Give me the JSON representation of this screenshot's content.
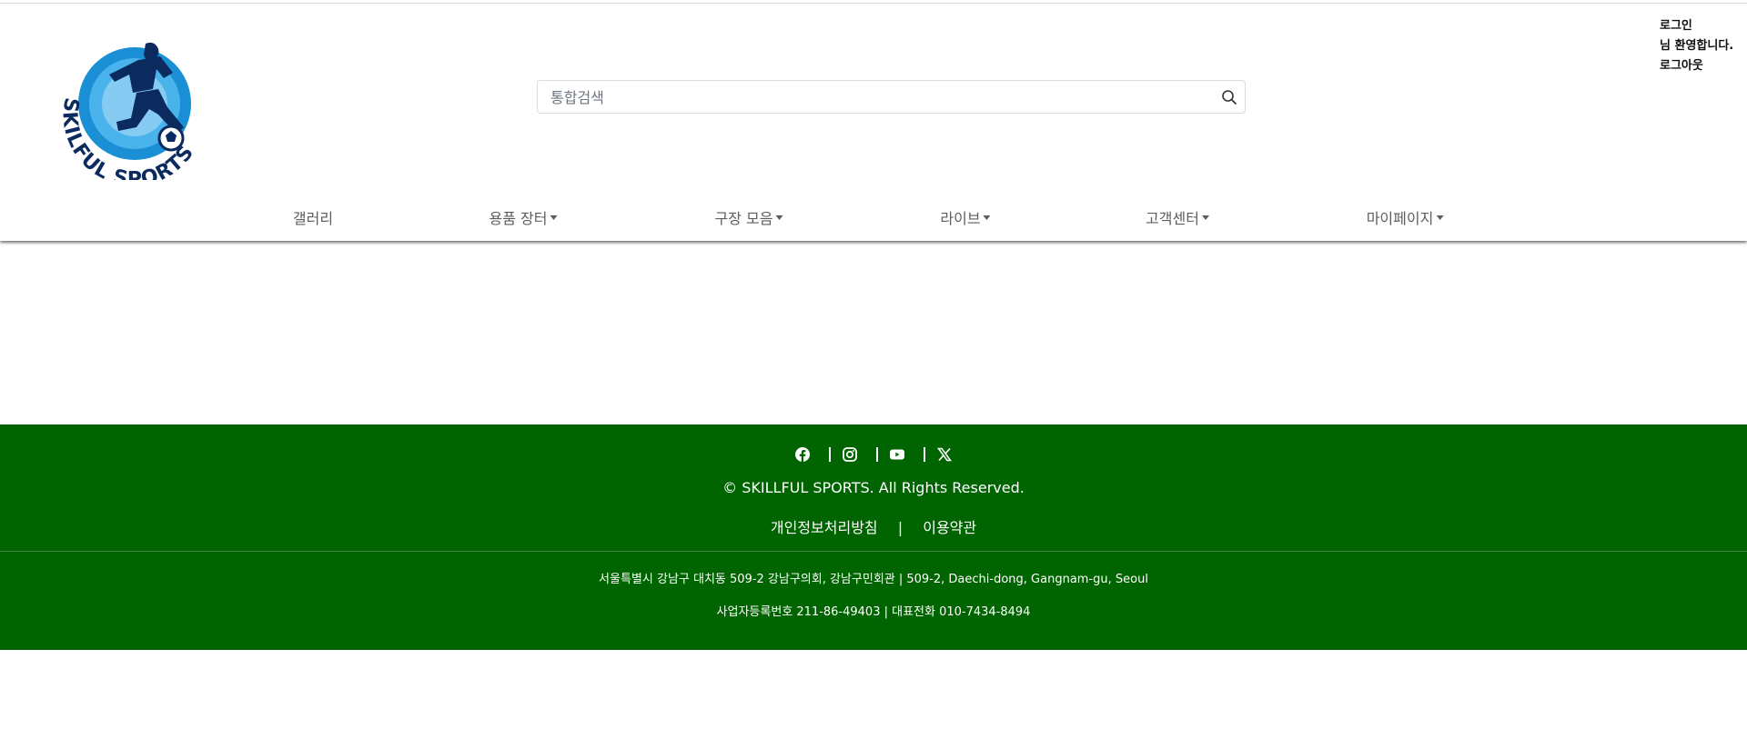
{
  "header": {
    "logo_text": "SKILFUL SPORTS",
    "search_placeholder": "통합검색",
    "user": {
      "login": "로그인",
      "welcome": "님 환영합니다.",
      "logout": "로그아웃"
    }
  },
  "nav": {
    "items": [
      {
        "label": "갤러리",
        "dropdown": false
      },
      {
        "label": "용품 장터",
        "dropdown": true
      },
      {
        "label": "구장 모음",
        "dropdown": true
      },
      {
        "label": "라이브",
        "dropdown": true
      },
      {
        "label": "고객센터",
        "dropdown": true
      },
      {
        "label": "마이페이지",
        "dropdown": true
      }
    ]
  },
  "footer": {
    "social_icons": [
      "facebook-icon",
      "instagram-icon",
      "youtube-icon",
      "x-icon"
    ],
    "copyright": "© SKILLFUL SPORTS. All Rights Reserved.",
    "privacy": "개인정보처리방침",
    "separator": "|",
    "terms": "이용약관",
    "address": "서울특별시 강남구 대치동 509-2 강남구의회, 강남구민회관 | 509-2, Daechi-dong, Gangnam-gu, Seoul",
    "business": "사업자등록번호 211-86-49403 | 대표전화 010-7434-8494"
  },
  "colors": {
    "footer_bg": "#006400",
    "logo_blue": "#1a8fd6",
    "logo_navy": "#0b2a5e"
  }
}
